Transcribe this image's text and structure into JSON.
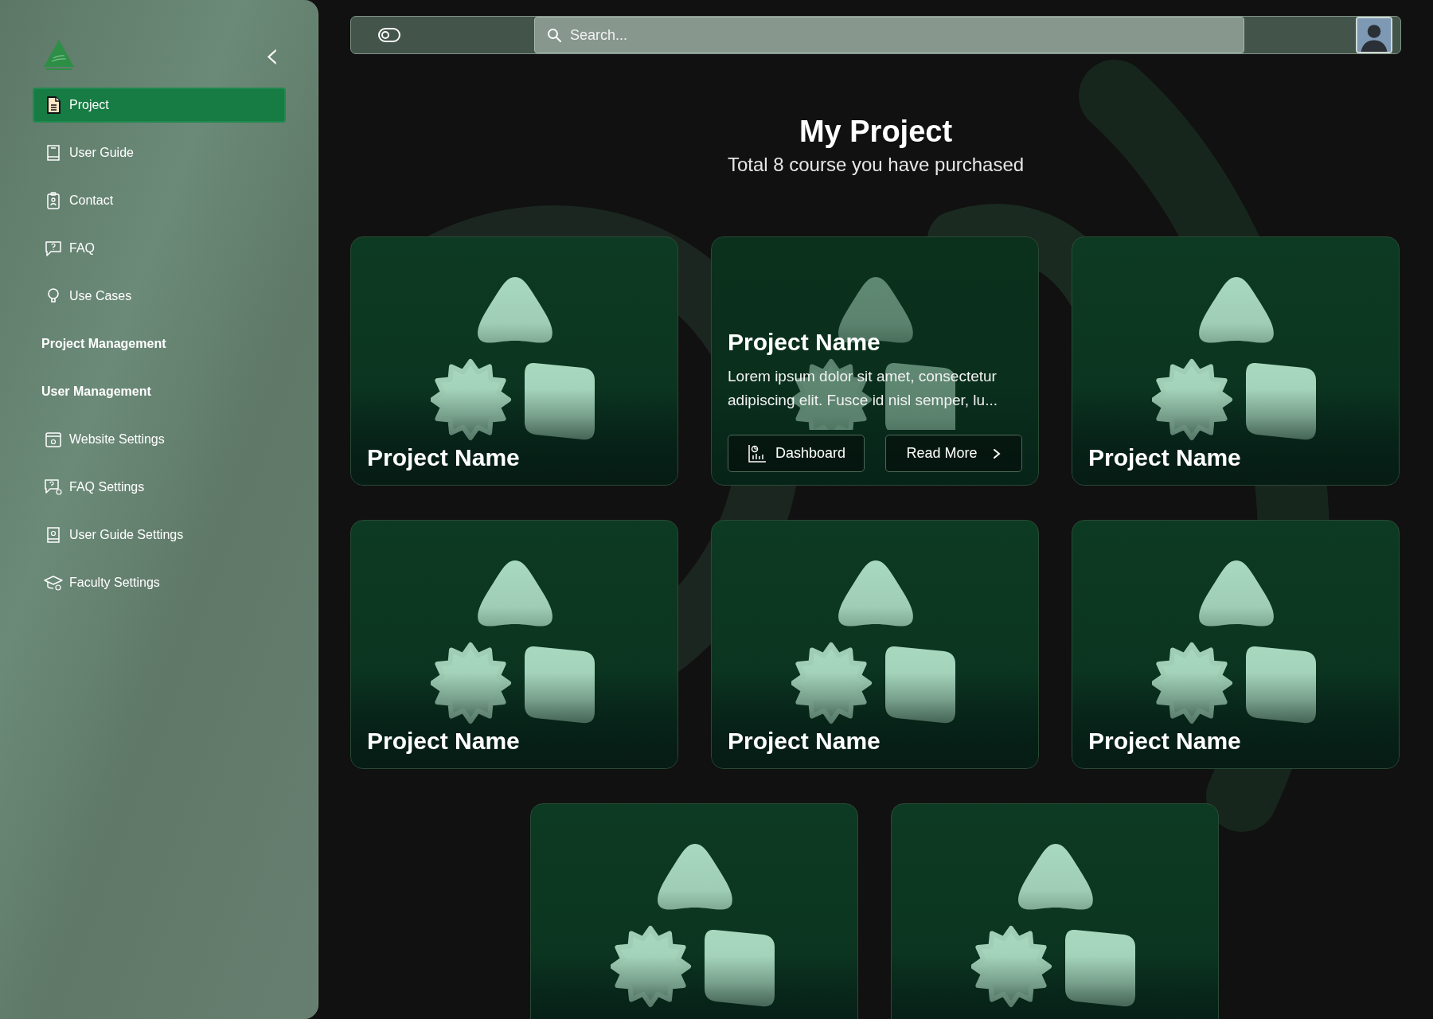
{
  "sidebar": {
    "collapse_button": "‹",
    "items": [
      {
        "kind": "link",
        "label": "Project",
        "selected": true
      },
      {
        "kind": "link",
        "label": "User Guide",
        "selected": false
      },
      {
        "kind": "link",
        "label": "Contact",
        "selected": false
      },
      {
        "kind": "link",
        "label": "FAQ",
        "selected": false
      },
      {
        "kind": "link",
        "label": "Use Cases",
        "selected": false
      },
      {
        "kind": "heading",
        "label": "Project Management",
        "selected": false
      },
      {
        "kind": "heading",
        "label": "User Management",
        "selected": false
      },
      {
        "kind": "link",
        "label": "Website Settings",
        "selected": false
      },
      {
        "kind": "link",
        "label": "FAQ Settings",
        "selected": false
      },
      {
        "kind": "link",
        "label": "User Guide Settings",
        "selected": false
      },
      {
        "kind": "link",
        "label": "Faculty Settings",
        "selected": false
      }
    ]
  },
  "topbar": {
    "search": {
      "placeholder": "Search..."
    }
  },
  "header": {
    "title": "My Project",
    "subtitle": "Total 8 course you have purchased"
  },
  "cards": [
    {
      "kind": "tile",
      "title": "Project Name"
    },
    {
      "kind": "detail",
      "title": "Project Name",
      "description": "Lorem ipsum dolor sit amet, consectetur adipiscing elit. Fusce id nisl semper, lu...",
      "buttons": [
        {
          "kind": "dashboard",
          "label": "Dashboard"
        },
        {
          "kind": "more",
          "label": "Read More"
        }
      ]
    },
    {
      "kind": "tile",
      "title": "Project Name"
    },
    {
      "kind": "tile",
      "title": "Project Name"
    },
    {
      "kind": "tile",
      "title": "Project Name"
    },
    {
      "kind": "tile",
      "title": "Project Name"
    },
    {
      "kind": "tile"
    },
    {
      "kind": "tile"
    }
  ]
}
